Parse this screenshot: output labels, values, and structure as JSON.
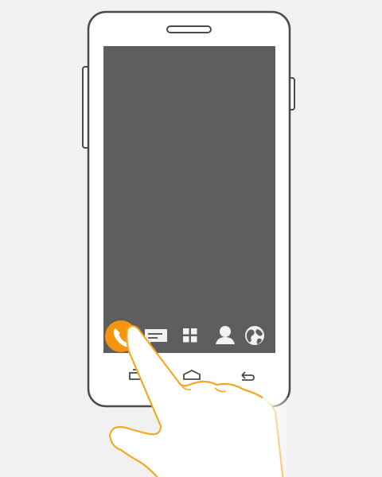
{
  "colors": {
    "background": "#f1f1f1",
    "phone_body": "#ffffff",
    "phone_outline": "#4a4a4a",
    "screen": "#5e5e5e",
    "icon_light": "#f2f2f2",
    "accent": "#f4940f",
    "hand_fill": "#ffffff",
    "hand_outline": "#f4a823"
  },
  "dock": {
    "icons": [
      {
        "name": "phone-icon",
        "highlighted": true
      },
      {
        "name": "messages-icon",
        "highlighted": false
      },
      {
        "name": "apps-grid-icon",
        "highlighted": false
      },
      {
        "name": "contacts-icon",
        "highlighted": false
      },
      {
        "name": "browser-globe-icon",
        "highlighted": false
      }
    ]
  },
  "nav_bar": {
    "icons": [
      "recent-apps-icon",
      "home-icon",
      "back-icon"
    ]
  }
}
